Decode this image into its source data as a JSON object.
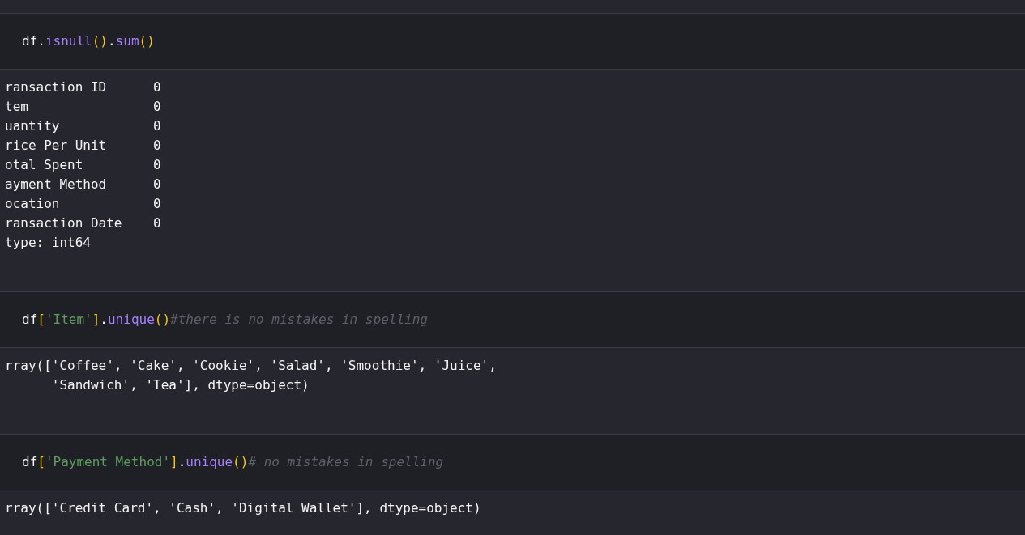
{
  "cells": [
    {
      "kind": "code",
      "tokens": [
        {
          "kind": "name",
          "text": "df"
        },
        {
          "kind": "plain",
          "text": "."
        },
        {
          "kind": "method",
          "text": "isnull"
        },
        {
          "kind": "paren",
          "text": "()"
        },
        {
          "kind": "plain",
          "text": "."
        },
        {
          "kind": "method",
          "text": "sum"
        },
        {
          "kind": "paren",
          "text": "()"
        }
      ]
    },
    {
      "kind": "output",
      "lines": [
        "ransaction ID      0",
        "tem                0",
        "uantity            0",
        "rice Per Unit      0",
        "otal Spent         0",
        "ayment Method      0",
        "ocation            0",
        "ransaction Date    0",
        "type: int64"
      ]
    },
    {
      "kind": "code",
      "tokens": [
        {
          "kind": "name",
          "text": "df"
        },
        {
          "kind": "paren",
          "text": "["
        },
        {
          "kind": "string",
          "text": "'Item'"
        },
        {
          "kind": "paren",
          "text": "]"
        },
        {
          "kind": "plain",
          "text": "."
        },
        {
          "kind": "method",
          "text": "unique"
        },
        {
          "kind": "paren",
          "text": "()"
        },
        {
          "kind": "comment",
          "text": "#there is no mistakes in spelling"
        }
      ]
    },
    {
      "kind": "output",
      "lines": [
        "rray(['Coffee', 'Cake', 'Cookie', 'Salad', 'Smoothie', 'Juice',",
        "      'Sandwich', 'Tea'], dtype=object)"
      ]
    },
    {
      "kind": "code",
      "tokens": [
        {
          "kind": "name",
          "text": "df"
        },
        {
          "kind": "paren",
          "text": "["
        },
        {
          "kind": "string",
          "text": "'Payment Method'"
        },
        {
          "kind": "paren",
          "text": "]"
        },
        {
          "kind": "plain",
          "text": "."
        },
        {
          "kind": "method",
          "text": "unique"
        },
        {
          "kind": "paren",
          "text": "()"
        },
        {
          "kind": "comment",
          "text": "# no mistakes in spelling"
        }
      ]
    },
    {
      "kind": "output",
      "lines": [
        "rray(['Credit Card', 'Cash', 'Digital Wallet'], dtype=object)"
      ]
    }
  ]
}
